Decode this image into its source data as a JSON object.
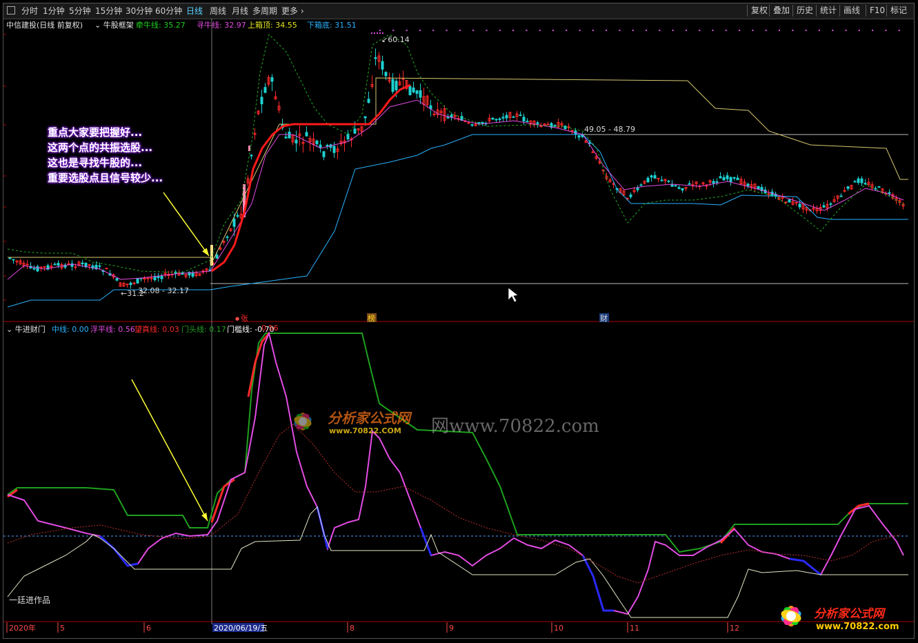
{
  "toolbar": {
    "periods": [
      "分时",
      "1分钟",
      "5分钟",
      "15分钟",
      "30分钟",
      "60分钟",
      "日线",
      "周线",
      "月线",
      "多周期",
      "更多"
    ],
    "active": "日线",
    "right": [
      "复权",
      "叠加",
      "历史",
      "统计",
      "画线",
      "F10",
      "标记"
    ]
  },
  "main_info": {
    "stock": "中信建投(日线 前复权)",
    "indicator": "牛股框架",
    "items": [
      {
        "label": "牵牛线: 35.27",
        "color": "#1ed11e"
      },
      {
        "label": "寻牛线: 32.97",
        "color": "#e34ce3"
      },
      {
        "label": "上箱顶: 34.55",
        "color": "#e6e61e"
      },
      {
        "label": "下箱底: 31.51",
        "color": "#2ab2ff"
      }
    ]
  },
  "sub_info": {
    "indicator": "牛进财门",
    "items": [
      {
        "label": "中线: 0.00",
        "color": "#2ab2ff"
      },
      {
        "label": "浮平线: 0.56",
        "color": "#e34ce3"
      },
      {
        "label": "望真线: 0.03",
        "color": "#ff2a2a"
      },
      {
        "label": "门头线: 0.17",
        "color": "#1ea01e"
      },
      {
        "label": "门槛线: -0.70",
        "color": "#ffffff"
      },
      {
        "label": "0.56",
        "color": "#ff2a2a"
      }
    ]
  },
  "annotation": [
    "重点大家要把握好...",
    "这两个点的共振选股...",
    "这也是寻找牛股的...",
    "重要选股点且信号较少..."
  ],
  "price_labels": {
    "high": "60.14",
    "box1": "32.08 - 32.17",
    "low_mark": "←31.2",
    "box2": "49.05 - 48.79"
  },
  "signals": [
    "张",
    "榜",
    "财"
  ],
  "credit": "一廷进作品",
  "watermark": {
    "site": "分析家公式网",
    "url": "www.70822.com",
    "url_mid": "网www.70822.com",
    "url_small": "www.70822.COM"
  },
  "date_axis": {
    "labels": [
      "2020年",
      "5",
      "6",
      "2020/06/19/五",
      "8",
      "9",
      "10",
      "11",
      "12"
    ]
  },
  "colors": {
    "up": "#ff2a2a",
    "down": "#1ed1d1",
    "bg": "#000000"
  },
  "chart_data": {
    "type": "candlestick",
    "title": "中信建投(日线 前复权)",
    "high": 60.14,
    "box_levels": [
      32.08,
      32.17,
      49.05,
      48.79
    ],
    "latest": {
      "牵牛线": 35.27,
      "寻牛线": 32.97,
      "上箱顶": 34.55,
      "下箱底": 31.51
    },
    "sub_latest": {
      "中线": 0.0,
      "浮平线": 0.56,
      "望真线": 0.03,
      "门头线": 0.17,
      "门槛线": -0.7
    }
  }
}
